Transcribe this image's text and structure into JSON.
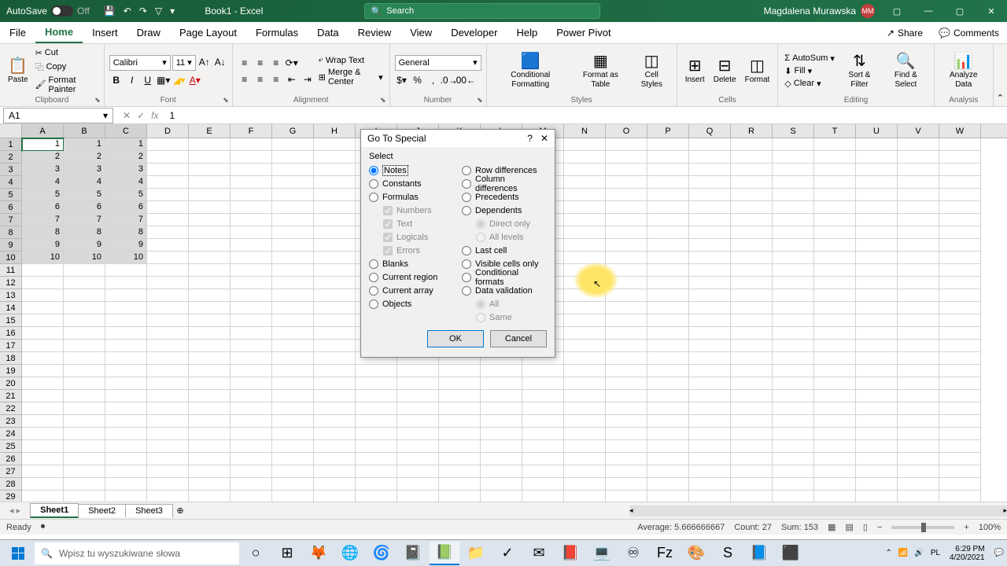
{
  "title_bar": {
    "autosave": "AutoSave",
    "autosave_off": "Off",
    "title": "Book1 - Excel",
    "search_placeholder": "Search",
    "user_name": "Magdalena Murawska",
    "user_initials": "MM"
  },
  "tabs": {
    "file": "File",
    "home": "Home",
    "insert": "Insert",
    "draw": "Draw",
    "page_layout": "Page Layout",
    "formulas": "Formulas",
    "data": "Data",
    "review": "Review",
    "view": "View",
    "developer": "Developer",
    "help": "Help",
    "power_pivot": "Power Pivot",
    "share": "Share",
    "comments": "Comments"
  },
  "ribbon": {
    "paste": "Paste",
    "cut": "Cut",
    "copy": "Copy",
    "format_painter": "Format Painter",
    "clipboard": "Clipboard",
    "font_name": "Calibri",
    "font_size": "11",
    "font": "Font",
    "alignment": "Alignment",
    "wrap_text": "Wrap Text",
    "merge_center": "Merge & Center",
    "number_format": "General",
    "number": "Number",
    "cond_format": "Conditional Formatting",
    "format_table": "Format as Table",
    "cell_styles": "Cell Styles",
    "styles": "Styles",
    "insert": "Insert",
    "delete": "Delete",
    "format": "Format",
    "cells": "Cells",
    "autosum": "AutoSum",
    "fill": "Fill",
    "clear": "Clear",
    "sort_filter": "Sort & Filter",
    "find_select": "Find & Select",
    "editing": "Editing",
    "analyze_data": "Analyze Data",
    "analysis": "Analysis"
  },
  "formula_bar": {
    "name_box": "A1",
    "formula": "1"
  },
  "columns": [
    "A",
    "B",
    "C",
    "D",
    "E",
    "F",
    "G",
    "H",
    "I",
    "J",
    "K",
    "L",
    "M",
    "N",
    "O",
    "P",
    "Q",
    "R",
    "S",
    "T",
    "U",
    "V",
    "W"
  ],
  "cell_data": {
    "rows": [
      {
        "A": "1",
        "B": "1",
        "C": "1"
      },
      {
        "A": "2",
        "B": "2",
        "C": "2"
      },
      {
        "A": "3",
        "B": "3",
        "C": "3"
      },
      {
        "A": "4",
        "B": "4",
        "C": "4"
      },
      {
        "A": "5",
        "B": "5",
        "C": "5"
      },
      {
        "A": "6",
        "B": "6",
        "C": "6"
      },
      {
        "A": "7",
        "B": "7",
        "C": "7"
      },
      {
        "A": "8",
        "B": "8",
        "C": "8"
      },
      {
        "A": "9",
        "B": "9",
        "C": "9"
      },
      {
        "A": "10",
        "B": "10",
        "C": "10"
      }
    ]
  },
  "dialog": {
    "title": "Go To Special",
    "section": "Select",
    "notes": "Notes",
    "constants": "Constants",
    "formulas": "Formulas",
    "numbers": "Numbers",
    "text": "Text",
    "logicals": "Logicals",
    "errors": "Errors",
    "blanks": "Blanks",
    "current_region": "Current region",
    "current_array": "Current array",
    "objects": "Objects",
    "row_diff": "Row differences",
    "col_diff": "Column differences",
    "precedents": "Precedents",
    "dependents": "Dependents",
    "direct_only": "Direct only",
    "all_levels": "All levels",
    "last_cell": "Last cell",
    "visible_cells": "Visible cells only",
    "cond_formats": "Conditional formats",
    "data_validation": "Data validation",
    "all": "All",
    "same": "Same",
    "ok": "OK",
    "cancel": "Cancel"
  },
  "sheets": {
    "sheet1": "Sheet1",
    "sheet2": "Sheet2",
    "sheet3": "Sheet3"
  },
  "status": {
    "ready": "Ready",
    "average": "Average: 5.666666667",
    "count": "Count: 27",
    "sum": "Sum: 153",
    "zoom": "100%"
  },
  "taskbar": {
    "search": "Wpisz tu wyszukiwane słowa",
    "time": "6:29 PM",
    "date": "4/20/2021"
  }
}
